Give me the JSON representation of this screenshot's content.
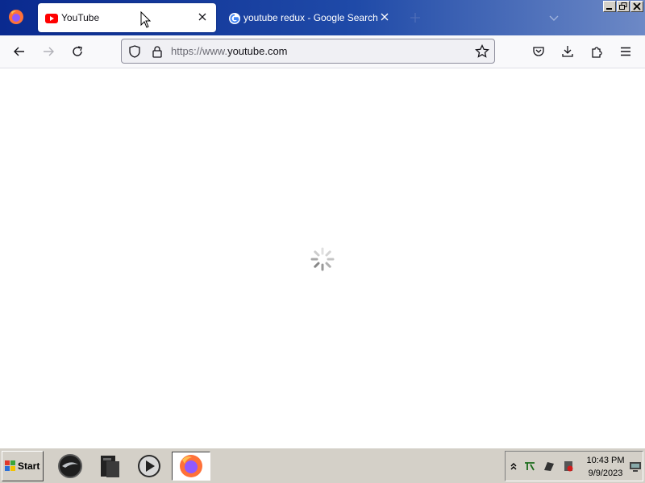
{
  "browser": {
    "tabs": [
      {
        "title": "YouTube",
        "favicon": "youtube-icon",
        "active": true
      },
      {
        "title": "youtube redux - Google Search",
        "favicon": "google-icon",
        "active": false
      }
    ],
    "url": {
      "prefix": "https://www.",
      "domain": "youtube.com"
    },
    "toolbar_icons": [
      "back-icon",
      "forward-icon",
      "reload-icon",
      "pocket-icon",
      "downloads-icon",
      "extensions-icon",
      "menu-icon"
    ],
    "page_state": "loading"
  },
  "taskbar": {
    "start_label": "Start",
    "apps": [
      "app-1-icon",
      "app-2-icon",
      "media-player-icon",
      "firefox-icon"
    ],
    "tray": {
      "time": "10:43 PM",
      "date": "9/9/2023"
    }
  },
  "colors": {
    "tabbar_start": "#0a2a8f",
    "tabbar_end": "#6d89c6",
    "youtube_red": "#ff0000",
    "taskbar": "#d4d0c8"
  }
}
